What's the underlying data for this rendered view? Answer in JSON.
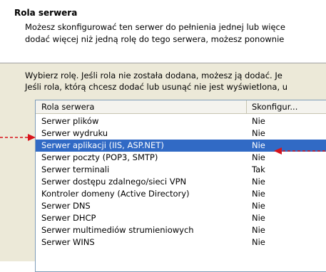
{
  "header": {
    "title": "Rola serwera",
    "line1": "Możesz skonfigurować ten serwer do pełnienia jednej lub więce",
    "line2": "dodać więcej niż jedną rolę do tego serwera, możesz ponownie"
  },
  "instructions": {
    "line1": "Wybierz rolę. Jeśli rola nie została dodana, możesz ją dodać. Je",
    "line2": "Jeśli rola, którą chcesz dodać lub usunąć nie jest wyświetlona, u"
  },
  "list": {
    "columns": [
      "Rola serwera",
      "Skonfigur..."
    ],
    "rows": [
      {
        "role": "Serwer plików",
        "configured": "Nie"
      },
      {
        "role": "Serwer wydruku",
        "configured": "Nie"
      },
      {
        "role": "Serwer aplikacji (IIS, ASP.NET)",
        "configured": "Nie",
        "selected": true
      },
      {
        "role": "Serwer poczty (POP3, SMTP)",
        "configured": "Nie"
      },
      {
        "role": "Serwer terminali",
        "configured": "Tak"
      },
      {
        "role": "Serwer dostępu zdalnego/sieci VPN",
        "configured": "Nie"
      },
      {
        "role": "Kontroler domeny (Active Directory)",
        "configured": "Nie"
      },
      {
        "role": "Serwer DNS",
        "configured": "Nie"
      },
      {
        "role": "Serwer DHCP",
        "configured": "Nie"
      },
      {
        "role": "Serwer multimediów strumieniowych",
        "configured": "Nie"
      },
      {
        "role": "Serwer WINS",
        "configured": "Nie"
      }
    ]
  },
  "annotations": {
    "arrow_color": "#d8141c"
  }
}
